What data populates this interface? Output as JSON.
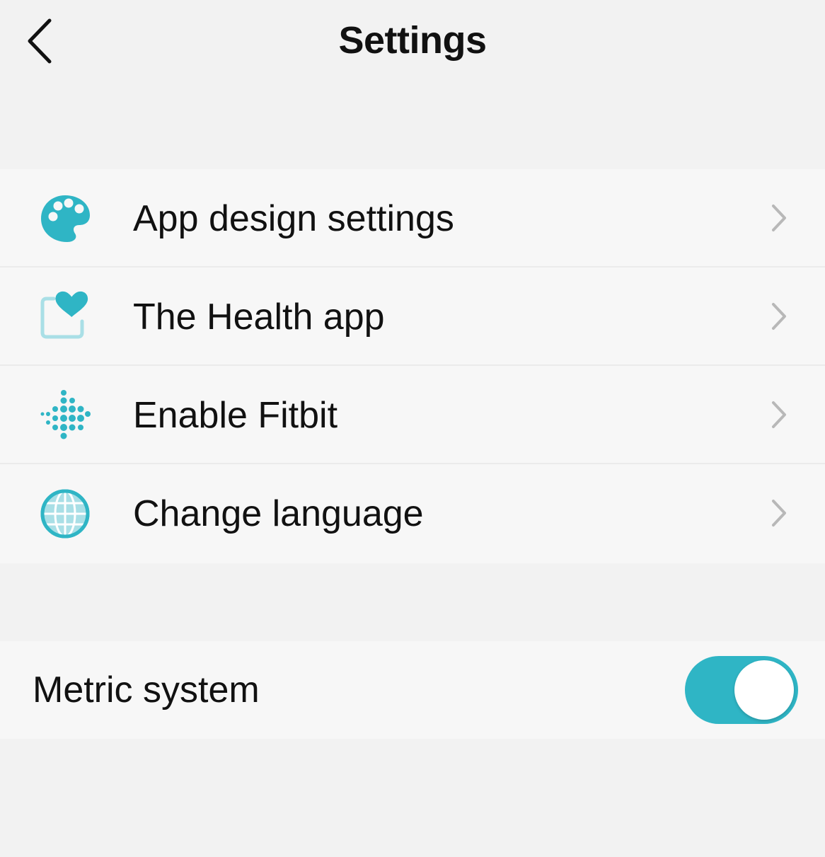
{
  "header": {
    "title": "Settings",
    "back_icon": "chevron-left-icon"
  },
  "settings": {
    "items": [
      {
        "label": "App design settings",
        "icon": "palette-icon"
      },
      {
        "label": "The Health app",
        "icon": "health-app-icon"
      },
      {
        "label": "Enable Fitbit",
        "icon": "fitbit-icon"
      },
      {
        "label": "Change language",
        "icon": "globe-icon"
      }
    ]
  },
  "preferences": {
    "metric_label": "Metric system",
    "metric_enabled": true
  },
  "colors": {
    "accent": "#2fb5c5",
    "accent_light": "#a9dfe6",
    "background": "#f2f2f2",
    "row_background": "#f7f7f7",
    "chevron": "#b8b8b8"
  }
}
